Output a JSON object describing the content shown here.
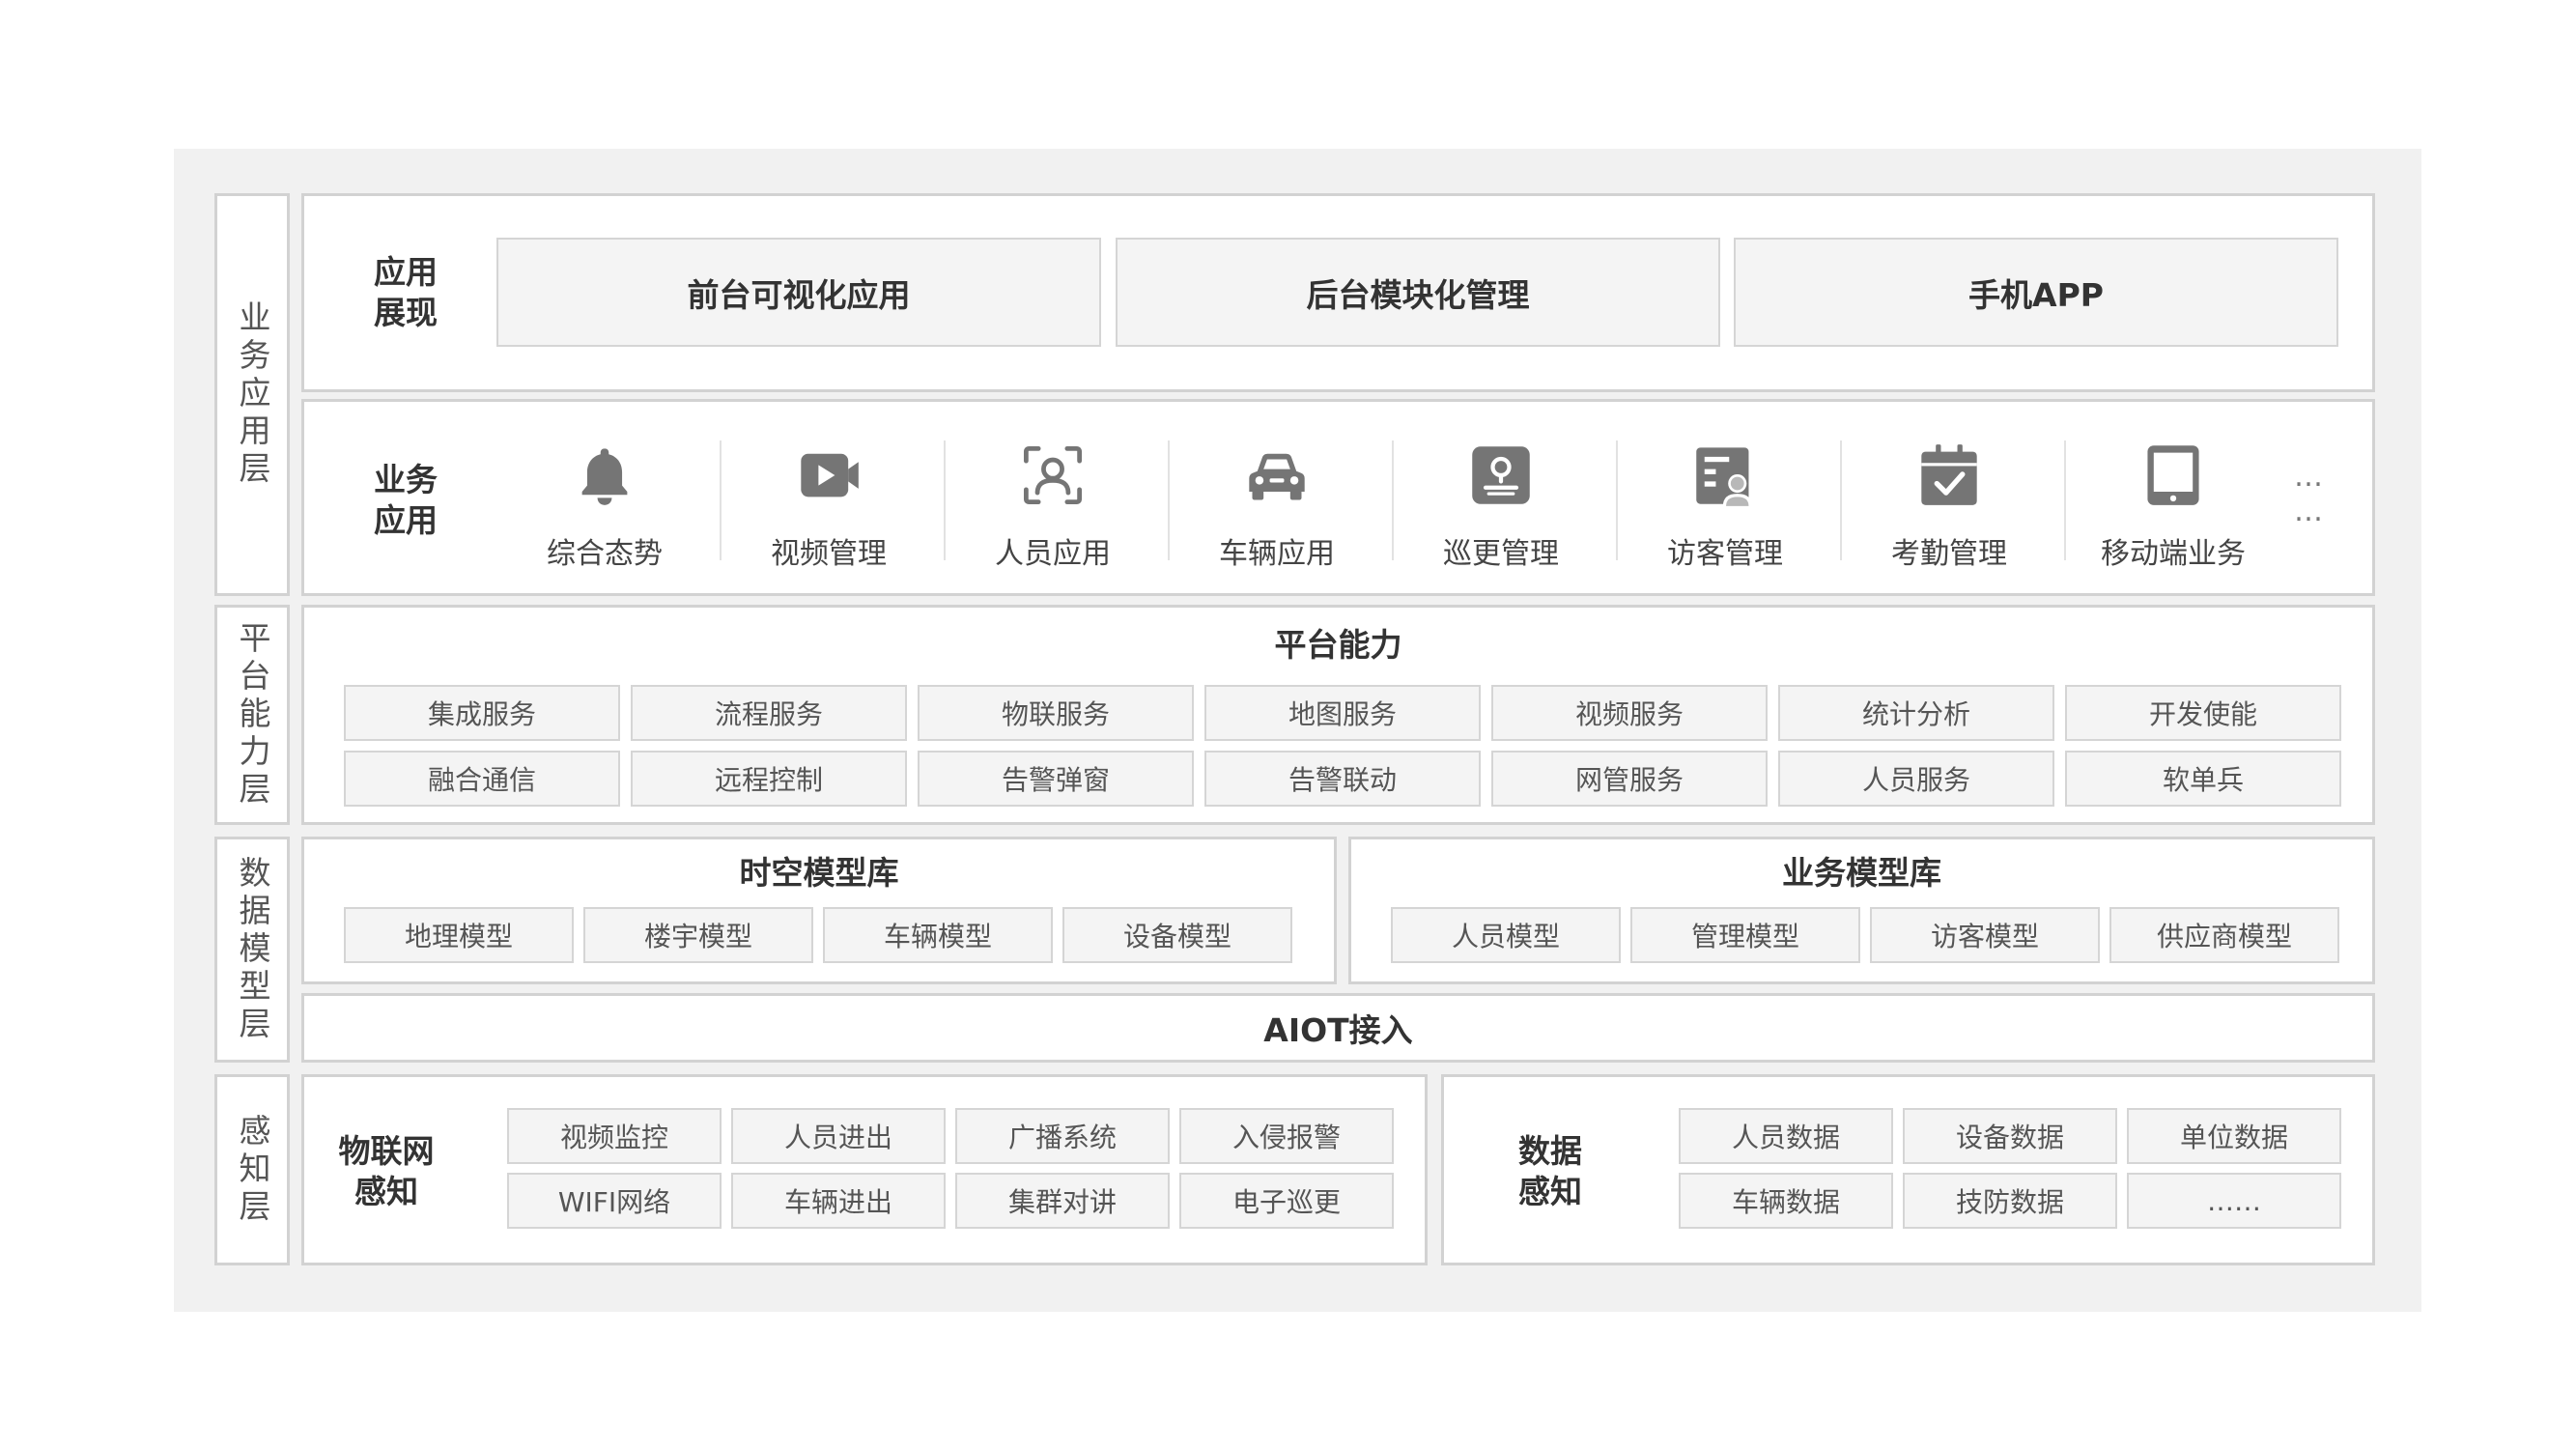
{
  "layers": {
    "business": "业务应用层",
    "platform": "平台能力层",
    "data_model": "数据模型层",
    "perception": "感知层"
  },
  "app_display": {
    "label_line1": "应用",
    "label_line2": "展现",
    "items": [
      "前台可视化应用",
      "后台模块化管理",
      "手机APP"
    ]
  },
  "business_apps": {
    "label_line1": "业务",
    "label_line2": "应用",
    "items": [
      {
        "label": "综合态势",
        "icon": "bell-icon"
      },
      {
        "label": "视频管理",
        "icon": "video-camera-icon"
      },
      {
        "label": "人员应用",
        "icon": "face-scan-icon"
      },
      {
        "label": "车辆应用",
        "icon": "car-icon"
      },
      {
        "label": "巡更管理",
        "icon": "patrol-checkpoint-icon"
      },
      {
        "label": "访客管理",
        "icon": "visitor-card-icon"
      },
      {
        "label": "考勤管理",
        "icon": "calendar-check-icon"
      },
      {
        "label": "移动端业务",
        "icon": "tablet-icon"
      }
    ],
    "more_line1": "…",
    "more_line2": "…"
  },
  "platform": {
    "title": "平台能力",
    "row1": [
      "集成服务",
      "流程服务",
      "物联服务",
      "地图服务",
      "视频服务",
      "统计分析",
      "开发使能"
    ],
    "row2": [
      "融合通信",
      "远程控制",
      "告警弹窗",
      "告警联动",
      "网管服务",
      "人员服务",
      "软单兵"
    ]
  },
  "spatial_models": {
    "title": "时空模型库",
    "items": [
      "地理模型",
      "楼宇模型",
      "车辆模型",
      "设备模型"
    ]
  },
  "business_models": {
    "title": "业务模型库",
    "items": [
      "人员模型",
      "管理模型",
      "访客模型",
      "供应商模型"
    ]
  },
  "aiot": {
    "title": "AIOT接入"
  },
  "iot": {
    "label_line1": "物联网",
    "label_line2": "感知",
    "row1": [
      "视频监控",
      "人员进出",
      "广播系统",
      "入侵报警"
    ],
    "row2": [
      "WIFI网络",
      "车辆进出",
      "集群对讲",
      "电子巡更"
    ]
  },
  "data_perception": {
    "label_line1": "数据",
    "label_line2": "感知",
    "row1": [
      "人员数据",
      "设备数据",
      "单位数据"
    ],
    "row2": [
      "车辆数据",
      "技防数据",
      "……"
    ]
  },
  "colors": {
    "background": "#f1f1f1",
    "panel": "#ffffff",
    "border": "#d2d2d2",
    "cell": "#f4f4f4",
    "icon": "#757575",
    "text": "#333333"
  }
}
